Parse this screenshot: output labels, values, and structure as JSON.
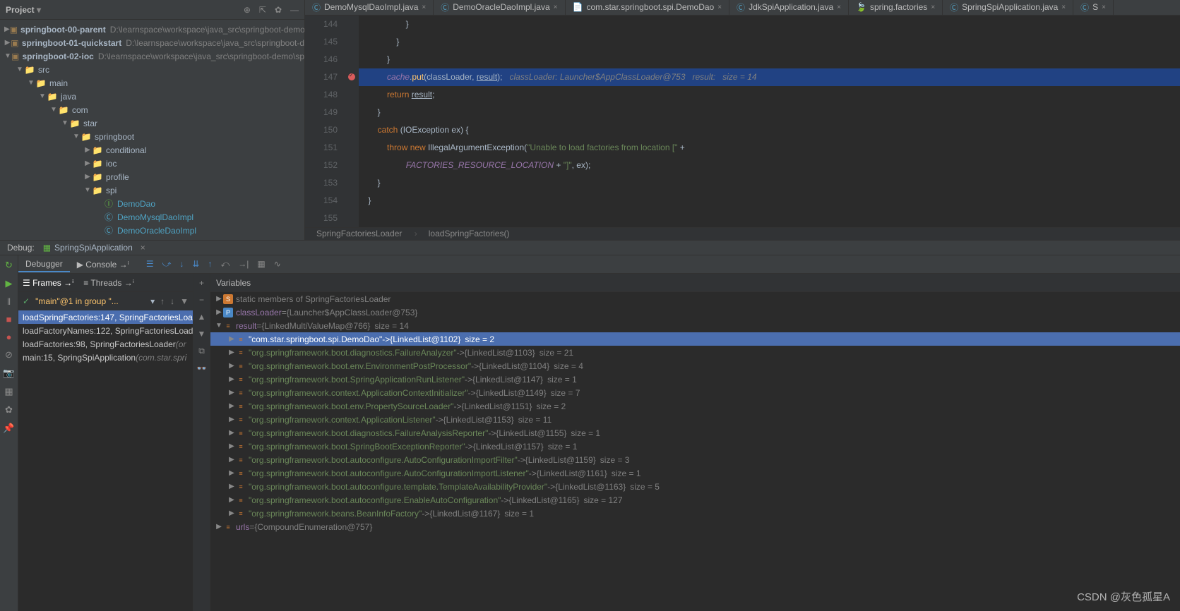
{
  "project": {
    "title": "Project",
    "tree": [
      {
        "name": "springboot-00-parent",
        "path": "D:\\learnspace\\workspace\\java_src\\springboot-demo",
        "indent": 0,
        "tri": "▶",
        "ico": "▣",
        "mod": true
      },
      {
        "name": "springboot-01-quickstart",
        "path": "D:\\learnspace\\workspace\\java_src\\springboot-d",
        "indent": 0,
        "tri": "▶",
        "ico": "▣",
        "mod": true
      },
      {
        "name": "springboot-02-ioc",
        "path": "D:\\learnspace\\workspace\\java_src\\springboot-demo\\sp",
        "indent": 0,
        "tri": "▼",
        "ico": "▣",
        "mod": true
      },
      {
        "name": "src",
        "indent": 1,
        "tri": "▼",
        "ico": "📁"
      },
      {
        "name": "main",
        "indent": 2,
        "tri": "▼",
        "ico": "📁"
      },
      {
        "name": "java",
        "indent": 3,
        "tri": "▼",
        "ico": "📁",
        "blue": true
      },
      {
        "name": "com",
        "indent": 4,
        "tri": "▼",
        "ico": "📁"
      },
      {
        "name": "star",
        "indent": 5,
        "tri": "▼",
        "ico": "📁"
      },
      {
        "name": "springboot",
        "indent": 6,
        "tri": "▼",
        "ico": "📁"
      },
      {
        "name": "conditional",
        "indent": 7,
        "tri": "▶",
        "ico": "📁"
      },
      {
        "name": "ioc",
        "indent": 7,
        "tri": "▶",
        "ico": "📁"
      },
      {
        "name": "profile",
        "indent": 7,
        "tri": "▶",
        "ico": "📁"
      },
      {
        "name": "spi",
        "indent": 7,
        "tri": "▼",
        "ico": "📁"
      },
      {
        "name": "DemoDao",
        "indent": 8,
        "ico": "Ⓘ",
        "cls": true,
        "green": true
      },
      {
        "name": "DemoMysqlDaoImpl",
        "indent": 8,
        "ico": "Ⓒ",
        "cls": true
      },
      {
        "name": "DemoOracleDaoImpl",
        "indent": 8,
        "ico": "Ⓒ",
        "cls": true
      }
    ]
  },
  "tabs": [
    {
      "label": "DemoMysqlDaoImpl.java",
      "icon": "Ⓒ"
    },
    {
      "label": "DemoOracleDaoImpl.java",
      "icon": "Ⓒ"
    },
    {
      "label": "com.star.springboot.spi.DemoDao",
      "icon": "📄"
    },
    {
      "label": "JdkSpiApplication.java",
      "icon": "Ⓒ"
    },
    {
      "label": "spring.factories",
      "icon": "🍃"
    },
    {
      "label": "SpringSpiApplication.java",
      "icon": "Ⓒ"
    },
    {
      "label": "S",
      "icon": "Ⓒ"
    }
  ],
  "code": {
    "start": 144,
    "lines": [
      "                    }",
      "                }",
      "            }",
      "            cache.put(classLoader, result);   classLoader: Launcher$AppClassLoader@753   result:   size = 14",
      "            return result;",
      "        }",
      "        catch (IOException ex) {",
      "            throw new IllegalArgumentException(\"Unable to load factories from location [\" +",
      "                    FACTORIES_RESOURCE_LOCATION + \"]\", ex);",
      "        }",
      "    }",
      ""
    ],
    "bp_line": 147
  },
  "breadcrumb": [
    "SpringFactoriesLoader",
    "loadSpringFactories()"
  ],
  "debug": {
    "label": "Debug:",
    "app": "SpringSpiApplication",
    "tabs": {
      "debugger": "Debugger",
      "console": "Console"
    },
    "frames_hdr": "Frames",
    "threads_hdr": "Threads",
    "thread_sel": "\"main\"@1 in group \"...",
    "frames": [
      {
        "txt": "loadSpringFactories:147, SpringFactoriesLoa",
        "sel": true
      },
      {
        "txt": "loadFactoryNames:122, SpringFactoriesLoad"
      },
      {
        "txt": "loadFactories:98, SpringFactoriesLoader",
        "it": "(or"
      },
      {
        "txt": "main:15, SpringSpiApplication",
        "it": "(com.star.spri"
      }
    ],
    "vars_hdr": "Variables",
    "vars": [
      {
        "indent": 0,
        "tri": "▶",
        "ico": "s",
        "txt": "static members of SpringFactoriesLoader"
      },
      {
        "indent": 0,
        "tri": "▶",
        "ico": "p",
        "name": "classLoader",
        "val": "{Launcher$AppClassLoader@753}"
      },
      {
        "indent": 0,
        "tri": "▼",
        "ico": "eq",
        "name": "result",
        "val": "{LinkedMultiValueMap@766}",
        "size": "size = 14"
      },
      {
        "indent": 1,
        "tri": "▶",
        "ico": "eq",
        "str": "\"com.star.springboot.spi.DemoDao\"",
        "arrow": " -> ",
        "val": "{LinkedList@1102}",
        "size": "size = 2",
        "sel": true
      },
      {
        "indent": 1,
        "tri": "▶",
        "ico": "eq",
        "str": "\"org.springframework.boot.diagnostics.FailureAnalyzer\"",
        "arrow": " -> ",
        "val": "{LinkedList@1103}",
        "size": "size = 21"
      },
      {
        "indent": 1,
        "tri": "▶",
        "ico": "eq",
        "str": "\"org.springframework.boot.env.EnvironmentPostProcessor\"",
        "arrow": " -> ",
        "val": "{LinkedList@1104}",
        "size": "size = 4"
      },
      {
        "indent": 1,
        "tri": "▶",
        "ico": "eq",
        "str": "\"org.springframework.boot.SpringApplicationRunListener\"",
        "arrow": " -> ",
        "val": "{LinkedList@1147}",
        "size": "size = 1"
      },
      {
        "indent": 1,
        "tri": "▶",
        "ico": "eq",
        "str": "\"org.springframework.context.ApplicationContextInitializer\"",
        "arrow": " -> ",
        "val": "{LinkedList@1149}",
        "size": "size = 7"
      },
      {
        "indent": 1,
        "tri": "▶",
        "ico": "eq",
        "str": "\"org.springframework.boot.env.PropertySourceLoader\"",
        "arrow": " -> ",
        "val": "{LinkedList@1151}",
        "size": "size = 2"
      },
      {
        "indent": 1,
        "tri": "▶",
        "ico": "eq",
        "str": "\"org.springframework.context.ApplicationListener\"",
        "arrow": " -> ",
        "val": "{LinkedList@1153}",
        "size": "size = 11"
      },
      {
        "indent": 1,
        "tri": "▶",
        "ico": "eq",
        "str": "\"org.springframework.boot.diagnostics.FailureAnalysisReporter\"",
        "arrow": " -> ",
        "val": "{LinkedList@1155}",
        "size": "size = 1"
      },
      {
        "indent": 1,
        "tri": "▶",
        "ico": "eq",
        "str": "\"org.springframework.boot.SpringBootExceptionReporter\"",
        "arrow": " -> ",
        "val": "{LinkedList@1157}",
        "size": "size = 1"
      },
      {
        "indent": 1,
        "tri": "▶",
        "ico": "eq",
        "str": "\"org.springframework.boot.autoconfigure.AutoConfigurationImportFilter\"",
        "arrow": " -> ",
        "val": "{LinkedList@1159}",
        "size": "size = 3"
      },
      {
        "indent": 1,
        "tri": "▶",
        "ico": "eq",
        "str": "\"org.springframework.boot.autoconfigure.AutoConfigurationImportListener\"",
        "arrow": " -> ",
        "val": "{LinkedList@1161}",
        "size": "size = 1"
      },
      {
        "indent": 1,
        "tri": "▶",
        "ico": "eq",
        "str": "\"org.springframework.boot.autoconfigure.template.TemplateAvailabilityProvider\"",
        "arrow": " -> ",
        "val": "{LinkedList@1163}",
        "size": "size = 5"
      },
      {
        "indent": 1,
        "tri": "▶",
        "ico": "eq",
        "str": "\"org.springframework.boot.autoconfigure.EnableAutoConfiguration\"",
        "arrow": " -> ",
        "val": "{LinkedList@1165}",
        "size": "size = 127"
      },
      {
        "indent": 1,
        "tri": "▶",
        "ico": "eq",
        "str": "\"org.springframework.beans.BeanInfoFactory\"",
        "arrow": " -> ",
        "val": "{LinkedList@1167}",
        "size": "size = 1"
      },
      {
        "indent": 0,
        "tri": "▶",
        "ico": "eq",
        "name": "urls",
        "val": "{CompoundEnumeration@757}"
      }
    ]
  },
  "watermark": "CSDN @灰色孤星A"
}
